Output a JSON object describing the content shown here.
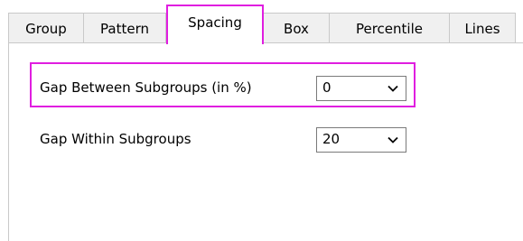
{
  "tabs": [
    {
      "label": "Group",
      "selected": false
    },
    {
      "label": "Pattern",
      "selected": false
    },
    {
      "label": "Spacing",
      "selected": true
    },
    {
      "label": "Box",
      "selected": false
    },
    {
      "label": "Percentile",
      "selected": false
    },
    {
      "label": "Lines",
      "selected": false
    }
  ],
  "fields": {
    "gap_between": {
      "label": "Gap Between Subgroups (in %)",
      "value": "0"
    },
    "gap_within": {
      "label": "Gap Within Subgroups",
      "value": "20"
    }
  },
  "colors": {
    "highlight": "#e01ee0"
  },
  "icons": {
    "dropdown": "chevron-down-icon"
  }
}
